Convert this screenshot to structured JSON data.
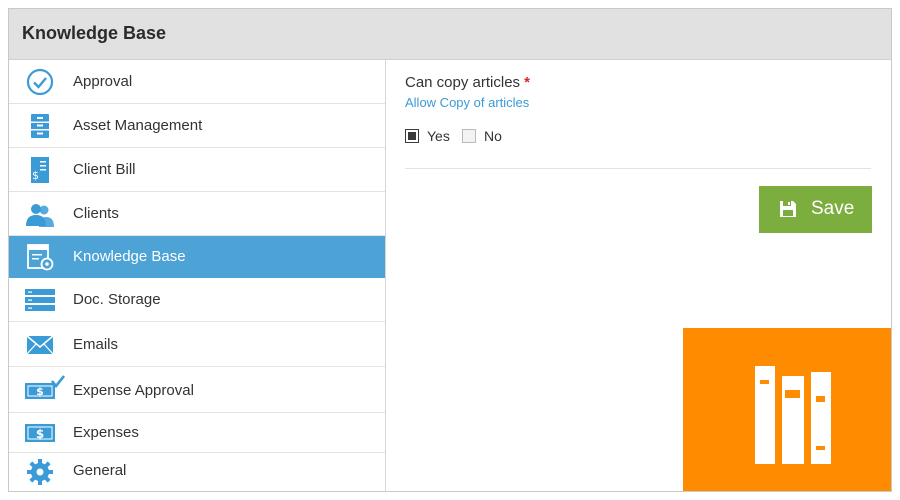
{
  "header": {
    "title": "Knowledge Base"
  },
  "sidebar": {
    "items": [
      {
        "label": "Approval",
        "icon": "check-circle-icon"
      },
      {
        "label": "Asset Management",
        "icon": "cabinet-icon"
      },
      {
        "label": "Client Bill",
        "icon": "bill-icon"
      },
      {
        "label": "Clients",
        "icon": "users-icon"
      },
      {
        "label": "Knowledge Base",
        "icon": "knowledge-base-icon",
        "active": true
      },
      {
        "label": "Doc. Storage",
        "icon": "storage-icon"
      },
      {
        "label": "Emails",
        "icon": "envelope-icon"
      },
      {
        "label": "Expense Approval",
        "icon": "money-check-icon"
      },
      {
        "label": "Expenses",
        "icon": "money-icon"
      },
      {
        "label": "General",
        "icon": "gear-icon"
      }
    ]
  },
  "main": {
    "field_label": "Can copy articles",
    "required_mark": "*",
    "field_help": "Allow Copy of articles",
    "options": [
      {
        "label": "Yes",
        "checked": true
      },
      {
        "label": "No",
        "checked": false
      }
    ],
    "save_label": "Save"
  },
  "colors": {
    "header_bg": "#e1e1e1",
    "active_item": "#4da2d6",
    "icon_blue": "#3a9bd6",
    "save_button": "#7cad3f",
    "promo_orange": "#ff8c00",
    "required": "#d9242d"
  }
}
